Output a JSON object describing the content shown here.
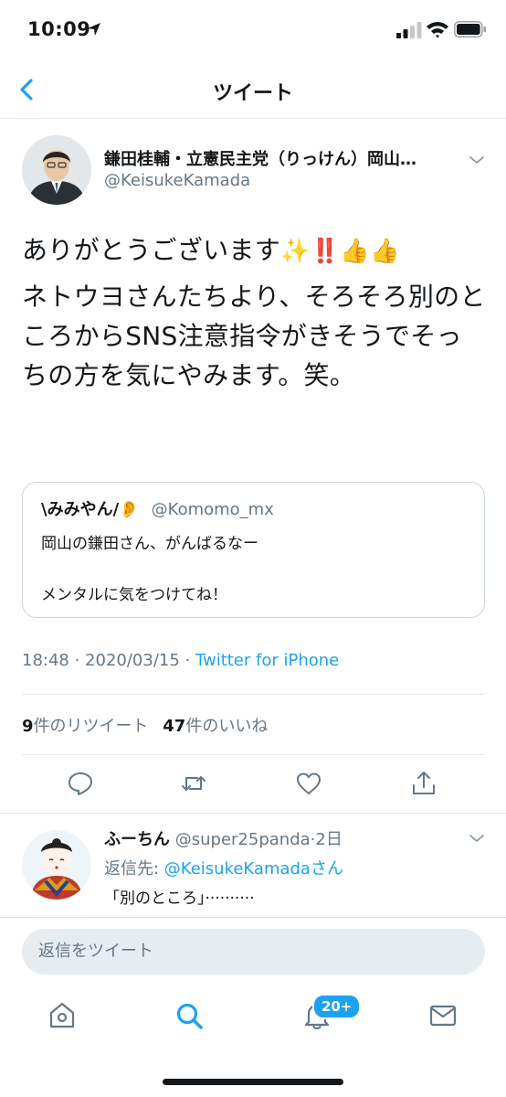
{
  "status_bar": {
    "time": "10:09"
  },
  "nav": {
    "title": "ツイート",
    "back_icon": "chevron-left-icon"
  },
  "tweet": {
    "author_name": "鎌田桂輔・立憲民主党（りっけん）岡山…",
    "author_handle": "@KeisukeKamada",
    "text_line1": "ありがとうございます",
    "text_line1_emoji": "✨‼️👍👍",
    "text_paragraph2": "ネトウヨさんたちより、そろそろ別のところからSNS注意指令がきそうでそっちの方を気にやみます。笑。",
    "quote": {
      "name": "\\みみやん/👂",
      "handle": "@Komomo_mx",
      "line1": "岡山の鎌田さん、がんばるなー",
      "line2": "メンタルに気をつけてね！"
    },
    "timestamp": "18:48 · 2020/03/15 · ",
    "source": "Twitter for iPhone",
    "retweet_count": "9",
    "retweet_label": "件のリツイート",
    "like_count": "47",
    "like_label": "件のいいね"
  },
  "reply": {
    "name": "ふーちん",
    "handle": "@super25panda",
    "time": "·2日",
    "reply_to_prefix": "返信先: ",
    "reply_to_user": "@KeisukeKamadaさん",
    "text": "「別のところ」··········"
  },
  "composer": {
    "placeholder": "返信をツイート"
  },
  "tab_bar": {
    "notifications_badge": "20+"
  },
  "colors": {
    "accent": "#1da1f2",
    "muted": "#657786",
    "border": "#e1e8ed"
  }
}
